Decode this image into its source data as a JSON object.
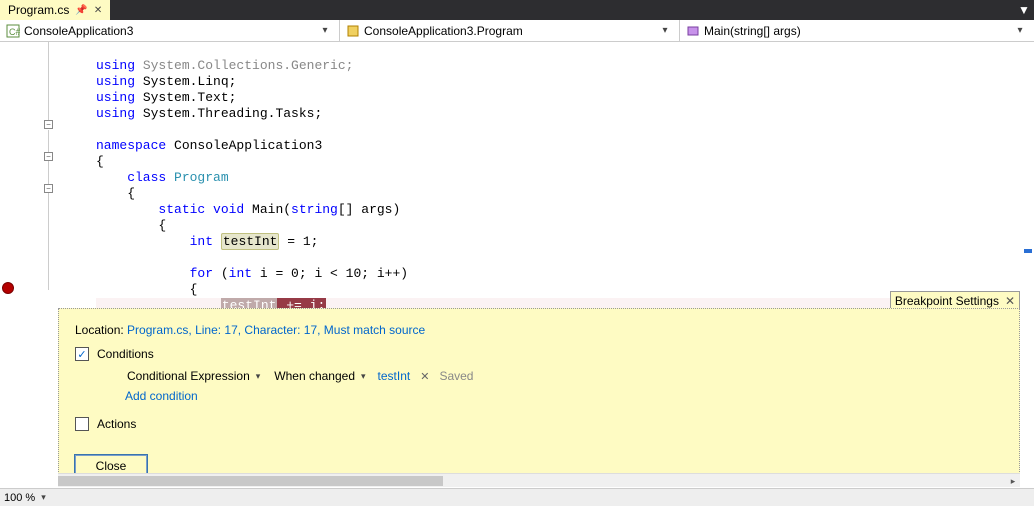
{
  "tab": {
    "label": "Program.cs",
    "pin_icon": "pin-icon",
    "close_icon": "close-icon"
  },
  "menu_caret": "▼",
  "nav": {
    "project": "ConsoleApplication3",
    "class": "ConsoleApplication3.Program",
    "method": "Main(string[] args)"
  },
  "side_button": "‡",
  "code": {
    "l1_a": "using",
    "l1_b": " System.Collections.Generic;",
    "l2_a": "using",
    "l2_b": " System.Linq;",
    "l3_a": "using",
    "l3_b": " System.Text;",
    "l4_a": "using",
    "l4_b": " System.Threading.Tasks;",
    "l6_a": "namespace",
    "l6_b": " ConsoleApplication3",
    "l7": "{",
    "l8_a": "    class",
    "l8_b": " Program",
    "l9": "    {",
    "l10_a": "        static",
    "l10_b": " void",
    "l10_c": " Main(",
    "l10_d": "string",
    "l10_e": "[] args)",
    "l11": "        {",
    "l12_a": "            int",
    "l12_b": " ",
    "l12_var": "testInt",
    "l12_c": " = 1;",
    "l14_a": "            for",
    "l14_b": " (",
    "l14_c": "int",
    "l14_d": " i = 0; i < 10; i++)",
    "l15": "            {",
    "l16_pad": "                ",
    "l16_var": "testInt",
    "l16_op": " += i;"
  },
  "bp_panel": {
    "title": "Breakpoint Settings",
    "location_label": "Location: ",
    "location_link": "Program.cs, Line: 17, Character: 17, Must match source",
    "conditions_label": "Conditions",
    "cond_type": "Conditional Expression",
    "cond_mode": "When changed",
    "cond_expr": "testInt",
    "saved": "Saved",
    "add_condition": "Add condition",
    "actions_label": "Actions",
    "close": "Close"
  },
  "footer": {
    "zoom": "100 %"
  }
}
